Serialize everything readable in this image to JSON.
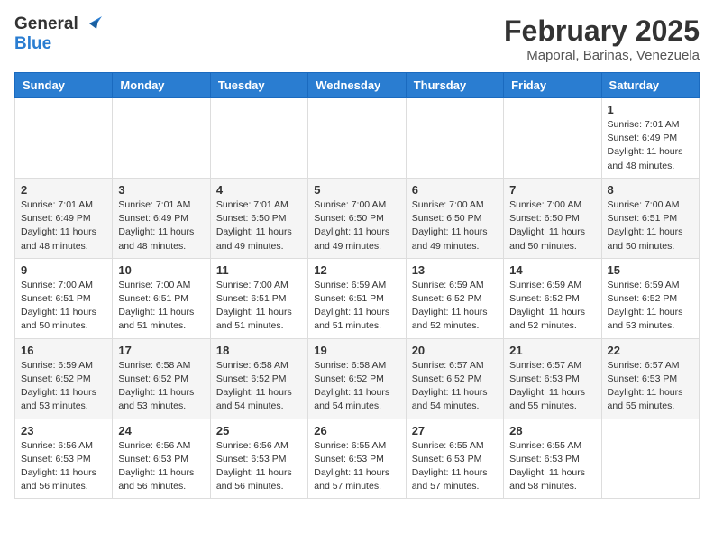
{
  "header": {
    "logo_general": "General",
    "logo_blue": "Blue",
    "month_title": "February 2025",
    "location": "Maporal, Barinas, Venezuela"
  },
  "weekdays": [
    "Sunday",
    "Monday",
    "Tuesday",
    "Wednesday",
    "Thursday",
    "Friday",
    "Saturday"
  ],
  "weeks": [
    [
      {
        "day": "",
        "info": ""
      },
      {
        "day": "",
        "info": ""
      },
      {
        "day": "",
        "info": ""
      },
      {
        "day": "",
        "info": ""
      },
      {
        "day": "",
        "info": ""
      },
      {
        "day": "",
        "info": ""
      },
      {
        "day": "1",
        "info": "Sunrise: 7:01 AM\nSunset: 6:49 PM\nDaylight: 11 hours\nand 48 minutes."
      }
    ],
    [
      {
        "day": "2",
        "info": "Sunrise: 7:01 AM\nSunset: 6:49 PM\nDaylight: 11 hours\nand 48 minutes."
      },
      {
        "day": "3",
        "info": "Sunrise: 7:01 AM\nSunset: 6:49 PM\nDaylight: 11 hours\nand 48 minutes."
      },
      {
        "day": "4",
        "info": "Sunrise: 7:01 AM\nSunset: 6:50 PM\nDaylight: 11 hours\nand 49 minutes."
      },
      {
        "day": "5",
        "info": "Sunrise: 7:00 AM\nSunset: 6:50 PM\nDaylight: 11 hours\nand 49 minutes."
      },
      {
        "day": "6",
        "info": "Sunrise: 7:00 AM\nSunset: 6:50 PM\nDaylight: 11 hours\nand 49 minutes."
      },
      {
        "day": "7",
        "info": "Sunrise: 7:00 AM\nSunset: 6:50 PM\nDaylight: 11 hours\nand 50 minutes."
      },
      {
        "day": "8",
        "info": "Sunrise: 7:00 AM\nSunset: 6:51 PM\nDaylight: 11 hours\nand 50 minutes."
      }
    ],
    [
      {
        "day": "9",
        "info": "Sunrise: 7:00 AM\nSunset: 6:51 PM\nDaylight: 11 hours\nand 50 minutes."
      },
      {
        "day": "10",
        "info": "Sunrise: 7:00 AM\nSunset: 6:51 PM\nDaylight: 11 hours\nand 51 minutes."
      },
      {
        "day": "11",
        "info": "Sunrise: 7:00 AM\nSunset: 6:51 PM\nDaylight: 11 hours\nand 51 minutes."
      },
      {
        "day": "12",
        "info": "Sunrise: 6:59 AM\nSunset: 6:51 PM\nDaylight: 11 hours\nand 51 minutes."
      },
      {
        "day": "13",
        "info": "Sunrise: 6:59 AM\nSunset: 6:52 PM\nDaylight: 11 hours\nand 52 minutes."
      },
      {
        "day": "14",
        "info": "Sunrise: 6:59 AM\nSunset: 6:52 PM\nDaylight: 11 hours\nand 52 minutes."
      },
      {
        "day": "15",
        "info": "Sunrise: 6:59 AM\nSunset: 6:52 PM\nDaylight: 11 hours\nand 53 minutes."
      }
    ],
    [
      {
        "day": "16",
        "info": "Sunrise: 6:59 AM\nSunset: 6:52 PM\nDaylight: 11 hours\nand 53 minutes."
      },
      {
        "day": "17",
        "info": "Sunrise: 6:58 AM\nSunset: 6:52 PM\nDaylight: 11 hours\nand 53 minutes."
      },
      {
        "day": "18",
        "info": "Sunrise: 6:58 AM\nSunset: 6:52 PM\nDaylight: 11 hours\nand 54 minutes."
      },
      {
        "day": "19",
        "info": "Sunrise: 6:58 AM\nSunset: 6:52 PM\nDaylight: 11 hours\nand 54 minutes."
      },
      {
        "day": "20",
        "info": "Sunrise: 6:57 AM\nSunset: 6:52 PM\nDaylight: 11 hours\nand 54 minutes."
      },
      {
        "day": "21",
        "info": "Sunrise: 6:57 AM\nSunset: 6:53 PM\nDaylight: 11 hours\nand 55 minutes."
      },
      {
        "day": "22",
        "info": "Sunrise: 6:57 AM\nSunset: 6:53 PM\nDaylight: 11 hours\nand 55 minutes."
      }
    ],
    [
      {
        "day": "23",
        "info": "Sunrise: 6:56 AM\nSunset: 6:53 PM\nDaylight: 11 hours\nand 56 minutes."
      },
      {
        "day": "24",
        "info": "Sunrise: 6:56 AM\nSunset: 6:53 PM\nDaylight: 11 hours\nand 56 minutes."
      },
      {
        "day": "25",
        "info": "Sunrise: 6:56 AM\nSunset: 6:53 PM\nDaylight: 11 hours\nand 56 minutes."
      },
      {
        "day": "26",
        "info": "Sunrise: 6:55 AM\nSunset: 6:53 PM\nDaylight: 11 hours\nand 57 minutes."
      },
      {
        "day": "27",
        "info": "Sunrise: 6:55 AM\nSunset: 6:53 PM\nDaylight: 11 hours\nand 57 minutes."
      },
      {
        "day": "28",
        "info": "Sunrise: 6:55 AM\nSunset: 6:53 PM\nDaylight: 11 hours\nand 58 minutes."
      },
      {
        "day": "",
        "info": ""
      }
    ]
  ]
}
